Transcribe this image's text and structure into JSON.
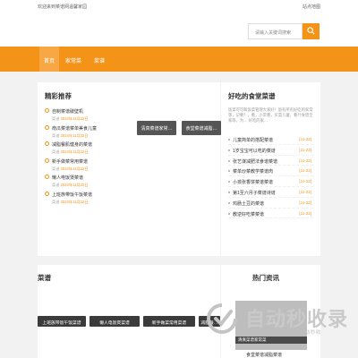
{
  "topbar": {
    "welcome": "欢迎来到菜谱网温馨家园",
    "sitemap": "站点地图"
  },
  "search": {
    "placeholder": "请输入关键词搜索"
  },
  "colors": {
    "accent": "#f39318",
    "dark": "#3b3b3b"
  },
  "nav": [
    "首页",
    "家常菜",
    "菜谱"
  ],
  "featured": {
    "title": "精彩推荐",
    "items": [
      {
        "title": "自制菜谱破壁机",
        "meta": "菜谱",
        "date": "2024年11月22日"
      },
      {
        "title": "南瓜菜谱菜单美食儿童",
        "meta": "菜谱",
        "date": "2024年11月22日"
      },
      {
        "title": "减脂餐肌健身的菜谱",
        "meta": "菜谱",
        "date": "2024年11月22日"
      },
      {
        "title": "新手做菜常用菜谱",
        "meta": "菜谱",
        "date": "2024年11月22日"
      },
      {
        "title": "懒人电饭煲菜谱",
        "meta": "菜谱",
        "date": "2024年11月22日"
      },
      {
        "title": "上班族带饭午饭菜谱",
        "meta": "菜谱",
        "date": "2024年11月22日"
      }
    ],
    "thumbs": [
      "清真菜谱家常…",
      "食堂菜谱减脂…"
    ]
  },
  "canteen": {
    "title": "好吃的食堂菜谱",
    "intro": "饭菜可可和饭菜管理大家好！饭有所有好吃的家常等，记要？，看，小常看，买菜儿童，看什食谱全家等，为… 好吃的家…",
    "items": [
      {
        "title": "儿童简单的搭配菜谱",
        "date": "[11-22]"
      },
      {
        "title": "1岁宝宝可以吃的菜谱",
        "date": "[11-22]"
      },
      {
        "title": "张艺谋减肥法食谱菜谱",
        "date": "[11-22]"
      },
      {
        "title": "菜单炒菜教学菜谱肉",
        "date": "[11-22]"
      },
      {
        "title": "小孩张香饼菜谱菜谱",
        "date": "[11-22]"
      },
      {
        "title": "第1至六月子菜谱诗谱",
        "date": "[11-22]"
      },
      {
        "title": "鸡肠土豆的菜谱",
        "date": "[11-22]"
      },
      {
        "title": "教逆好吃菜菜谱",
        "date": "[11-22]"
      }
    ]
  },
  "recipes": {
    "title": "菜谱",
    "bars": [
      "上班族带饭午饭菜谱",
      "懒人电饭煲菜谱",
      "新手做菜常用菜谱",
      "减脂餐…"
    ]
  },
  "hot": {
    "title": "热门资讯",
    "caption": "清真菜谱家常菜",
    "under": "食堂菜谱减脂菜谱"
  },
  "watermark": {
    "text": "自动秒收录",
    "sub": "放上链接 · 来访一次 · 自动秒收"
  }
}
